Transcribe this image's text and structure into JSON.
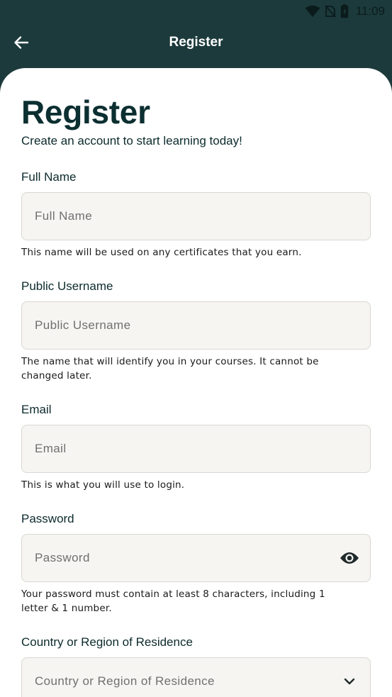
{
  "status_bar": {
    "time": "11:09",
    "icons": [
      "wifi-icon",
      "no-sim-icon",
      "battery-icon"
    ]
  },
  "app_bar": {
    "title": "Register",
    "back_icon": "arrow-left-icon"
  },
  "form": {
    "title": "Register",
    "subtitle": "Create an account to start learning today!",
    "full_name": {
      "label": "Full Name",
      "placeholder": "Full Name",
      "value": "",
      "helper": "This name will be used on any certificates that you earn."
    },
    "username": {
      "label": "Public Username",
      "placeholder": "Public Username",
      "value": "",
      "helper_line1": "The name that will identify you in your courses. It cannot be",
      "helper_line2": "changed later."
    },
    "email": {
      "label": "Email",
      "placeholder": "Email",
      "value": "",
      "helper": "This is what you will use to login."
    },
    "password": {
      "label": "Password",
      "placeholder": "Password",
      "value": "",
      "toggle_icon": "eye-icon",
      "helper_line1": "Your password must contain at least 8 characters, including 1",
      "helper_line2": "letter & 1 number."
    },
    "country": {
      "label": "Country or Region of Residence",
      "placeholder": "Country or Region of Residence",
      "dropdown_icon": "chevron-down-icon"
    }
  },
  "colors": {
    "header_bg": "#1c3a3c",
    "title": "#0c2f31",
    "input_bg": "#f7f5f2",
    "input_border": "#d9d7d3"
  }
}
